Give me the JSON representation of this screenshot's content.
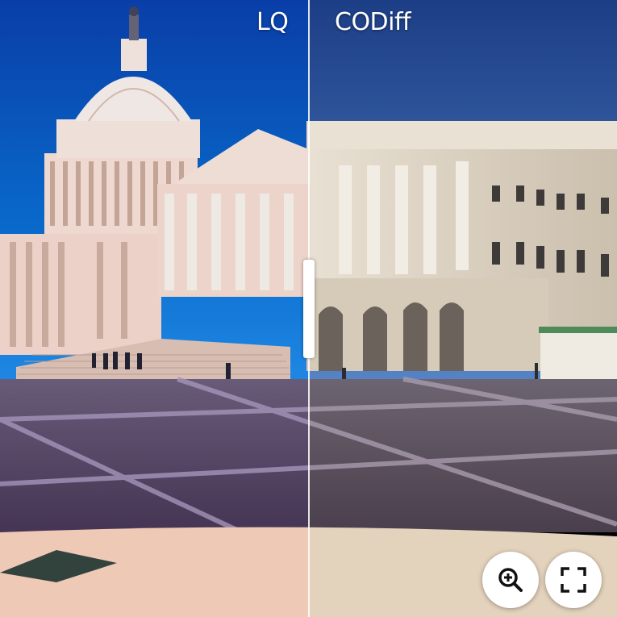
{
  "compare": {
    "left_label": "LQ",
    "right_label": "CODiff",
    "split_percent": 50
  },
  "controls": {
    "zoom_icon": "zoom-in-icon",
    "fullscreen_icon": "fullscreen-icon"
  },
  "colors": {
    "sky_top": "#1c3e86",
    "sky_bottom": "#4f7fc4",
    "stone": "#d9d1c2",
    "pavement": "#5a4f5c",
    "pavement_lines": "#9b8f98"
  }
}
